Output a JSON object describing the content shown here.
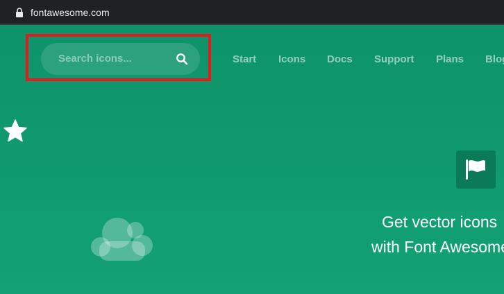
{
  "browser": {
    "url": "fontawesome.com"
  },
  "search": {
    "placeholder": "Search icons..."
  },
  "nav": {
    "items": [
      {
        "label": "Start"
      },
      {
        "label": "Icons"
      },
      {
        "label": "Docs"
      },
      {
        "label": "Support"
      },
      {
        "label": "Plans"
      },
      {
        "label": "Blog"
      }
    ]
  },
  "hero": {
    "line1": "Get vector icons",
    "line2": "with Font Awesome"
  },
  "icons": {
    "lock": "lock-icon",
    "search": "search-icon",
    "star": "star-icon",
    "cloud": "cloud-icon",
    "flag": "flag-icon"
  },
  "colors": {
    "background": "#139e73",
    "highlight_border": "#e51b1b",
    "url_bar": "#202124"
  }
}
